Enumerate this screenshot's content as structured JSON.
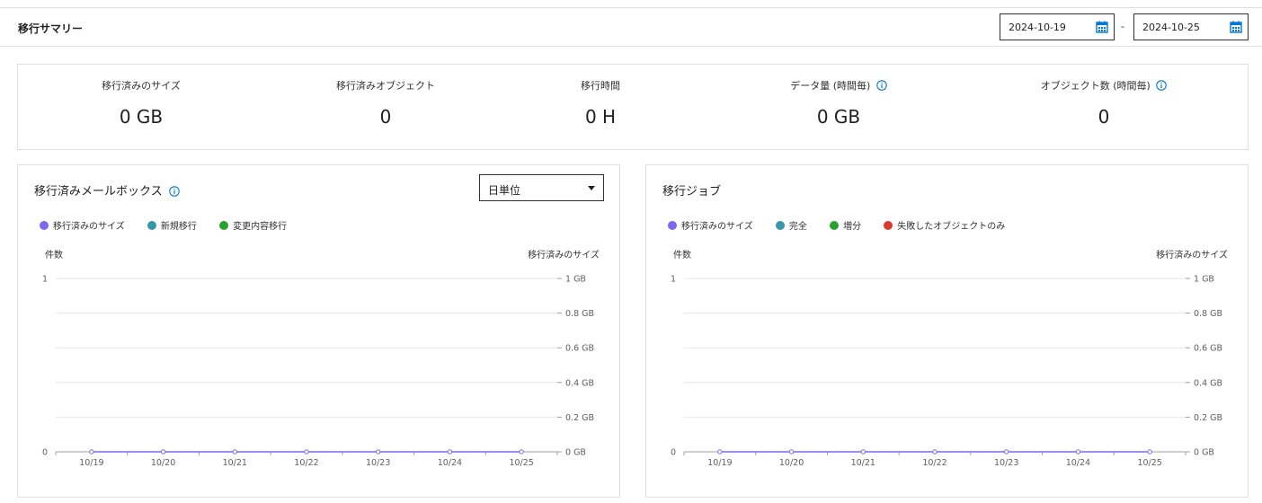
{
  "header": {
    "title": "移行サマリー",
    "start_date": "2024-10-19",
    "separator": "-",
    "end_date": "2024-10-25",
    "icon_calendar": "calendar-icon",
    "accent": "#0078d4"
  },
  "summary": {
    "stats": [
      {
        "label": "移行済みのサイズ",
        "value": "0 GB",
        "info": false
      },
      {
        "label": "移行済みオブジェクト",
        "value": "0",
        "info": false
      },
      {
        "label": "移行時間",
        "value": "0 H",
        "info": false
      },
      {
        "label": "データ量 (時間毎)",
        "value": "0 GB",
        "info": true
      },
      {
        "label": "オブジェクト数 (時間毎)",
        "value": "0",
        "info": true
      }
    ]
  },
  "mailbox_panel": {
    "title": "移行済みメールボックス",
    "dropdown_value": "日単位",
    "legend": [
      {
        "label": "移行済みのサイズ",
        "color": "#7b68ee"
      },
      {
        "label": "新規移行",
        "color": "#3597a8"
      },
      {
        "label": "変更内容移行",
        "color": "#2ca02c"
      }
    ],
    "y_left_title": "件数",
    "y_right_title": "移行済みのサイズ"
  },
  "jobs_panel": {
    "title": "移行ジョブ",
    "legend": [
      {
        "label": "移行済みのサイズ",
        "color": "#7b68ee"
      },
      {
        "label": "完全",
        "color": "#3597a8"
      },
      {
        "label": "増分",
        "color": "#2ca02c"
      },
      {
        "label": "失敗したオブジェクトのみ",
        "color": "#d93a2b"
      }
    ],
    "y_left_title": "件数",
    "y_right_title": "移行済みのサイズ"
  },
  "chart_data": [
    {
      "type": "line",
      "categories": [
        "10/19",
        "10/20",
        "10/21",
        "10/22",
        "10/23",
        "10/24",
        "10/25"
      ],
      "series": [
        {
          "name": "移行済みのサイズ",
          "values": [
            0,
            0,
            0,
            0,
            0,
            0,
            0
          ],
          "color": "#7b68ee"
        }
      ],
      "y_left_ticks": [
        "0",
        "1"
      ],
      "y_right_ticks": [
        "0 GB",
        "0.2 GB",
        "0.4 GB",
        "0.6 GB",
        "0.8 GB",
        "1 GB"
      ],
      "ylim": [
        0,
        1
      ],
      "grid": true
    },
    {
      "type": "line",
      "categories": [
        "10/19",
        "10/20",
        "10/21",
        "10/22",
        "10/23",
        "10/24",
        "10/25"
      ],
      "series": [
        {
          "name": "移行済みのサイズ",
          "values": [
            0,
            0,
            0,
            0,
            0,
            0,
            0
          ],
          "color": "#7b68ee"
        }
      ],
      "y_left_ticks": [
        "0",
        "1"
      ],
      "y_right_ticks": [
        "0 GB",
        "0.2 GB",
        "0.4 GB",
        "0.6 GB",
        "0.8 GB",
        "1 GB"
      ],
      "ylim": [
        0,
        1
      ],
      "grid": true
    }
  ]
}
